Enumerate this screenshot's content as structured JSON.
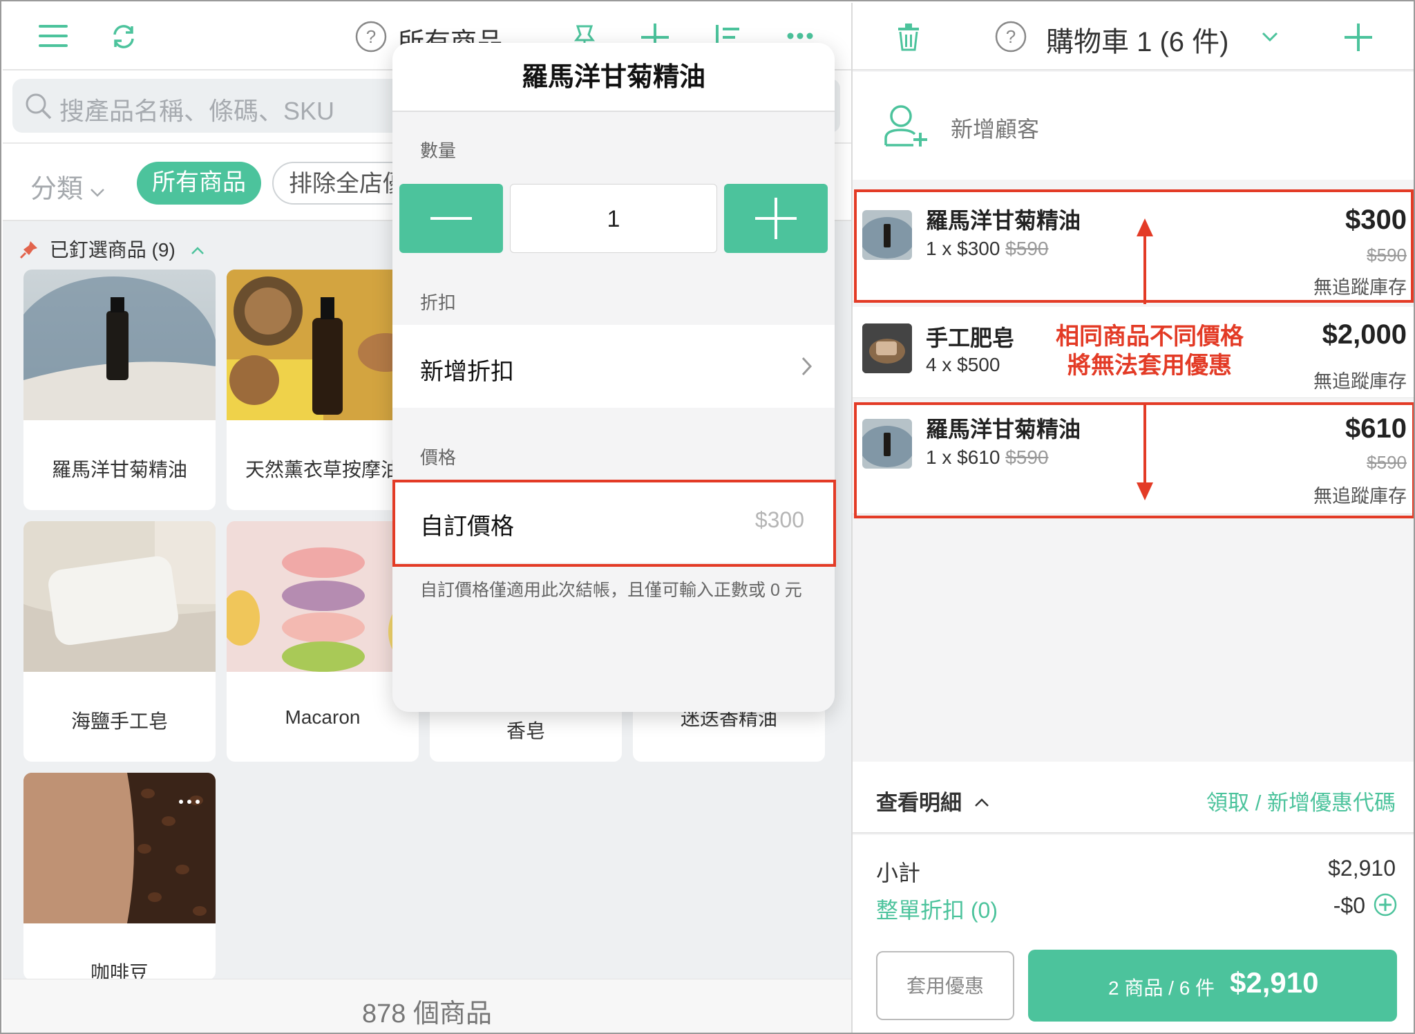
{
  "left": {
    "header": {
      "title": "所有商品"
    },
    "search": {
      "placeholder": "搜產品名稱、條碼、SKU"
    },
    "filters": {
      "category_label": "分類",
      "chips": [
        "所有商品",
        "排除全店優"
      ]
    },
    "pinned_label": "已釘選商品 (9)",
    "products": [
      {
        "name": "羅馬洋甘菊精油"
      },
      {
        "name": "天然薰衣草按摩油"
      },
      {
        "name": "海鹽手工皂"
      },
      {
        "name": "Macaron"
      },
      {
        "name": "香皂"
      },
      {
        "name": "迷迭香精油"
      },
      {
        "name": "咖啡豆"
      }
    ],
    "footer": "878 個商品"
  },
  "modal": {
    "title": "羅馬洋甘菊精油",
    "quantity_label": "數量",
    "quantity_value": "1",
    "discount_label": "折扣",
    "add_discount": "新增折扣",
    "price_label": "價格",
    "custom_price_label": "自訂價格",
    "custom_price_placeholder": "$300",
    "note": "自訂價格僅適用此次結帳，且僅可輸入正數或 0 元"
  },
  "cart": {
    "title": "購物車 1 (6 件)",
    "add_customer": "新增顧客",
    "items": [
      {
        "name": "羅馬洋甘菊精油",
        "qty_price": "1 x $300",
        "orig_unit": "$590",
        "total": "$300",
        "orig_total": "$590",
        "stock": "無追蹤庫存"
      },
      {
        "name": "手工肥皂",
        "qty_price": "4 x $500",
        "orig_unit": "",
        "total": "$2,000",
        "orig_total": "",
        "stock": "無追蹤庫存"
      },
      {
        "name": "羅馬洋甘菊精油",
        "qty_price": "1 x $610",
        "orig_unit": "$590",
        "total": "$610",
        "orig_total": "$590",
        "stock": "無追蹤庫存"
      }
    ],
    "annotation_line1": "相同商品不同價格",
    "annotation_line2": "將無法套用優惠",
    "detail_label": "查看明細",
    "coupon_link": "領取 / 新增優惠代碼",
    "subtotal_label": "小計",
    "subtotal_value": "$2,910",
    "order_discount_label": "整單折扣 (0)",
    "order_discount_value": "-$0",
    "apply_coupon": "套用優惠",
    "checkout_summary": "2 商品 / 6 件",
    "checkout_total": "$2,910"
  },
  "colors": {
    "accent": "#4cc39c",
    "annotation": "#e33b26"
  }
}
